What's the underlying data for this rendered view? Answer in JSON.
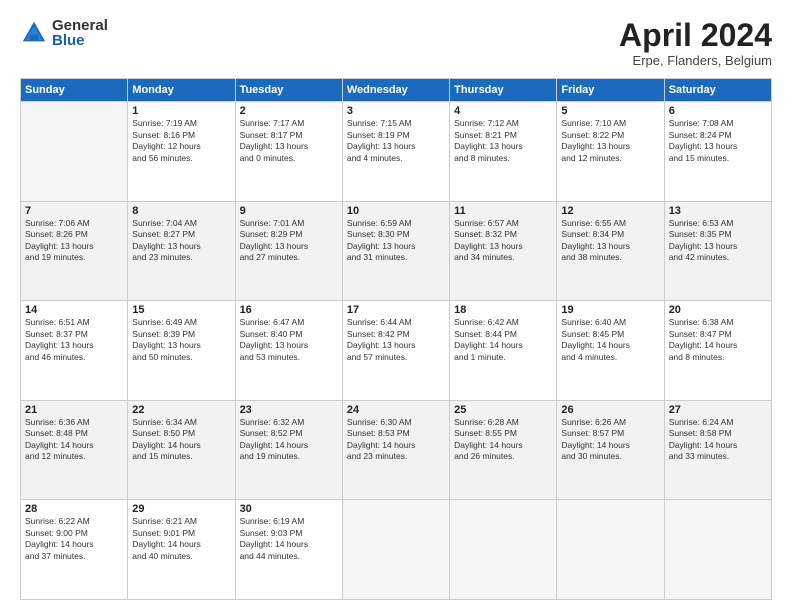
{
  "header": {
    "logo_general": "General",
    "logo_blue": "Blue",
    "title": "April 2024",
    "location": "Erpe, Flanders, Belgium"
  },
  "days_of_week": [
    "Sunday",
    "Monday",
    "Tuesday",
    "Wednesday",
    "Thursday",
    "Friday",
    "Saturday"
  ],
  "weeks": [
    [
      {
        "day": "",
        "info": ""
      },
      {
        "day": "1",
        "info": "Sunrise: 7:19 AM\nSunset: 8:16 PM\nDaylight: 12 hours\nand 56 minutes."
      },
      {
        "day": "2",
        "info": "Sunrise: 7:17 AM\nSunset: 8:17 PM\nDaylight: 13 hours\nand 0 minutes."
      },
      {
        "day": "3",
        "info": "Sunrise: 7:15 AM\nSunset: 8:19 PM\nDaylight: 13 hours\nand 4 minutes."
      },
      {
        "day": "4",
        "info": "Sunrise: 7:12 AM\nSunset: 8:21 PM\nDaylight: 13 hours\nand 8 minutes."
      },
      {
        "day": "5",
        "info": "Sunrise: 7:10 AM\nSunset: 8:22 PM\nDaylight: 13 hours\nand 12 minutes."
      },
      {
        "day": "6",
        "info": "Sunrise: 7:08 AM\nSunset: 8:24 PM\nDaylight: 13 hours\nand 15 minutes."
      }
    ],
    [
      {
        "day": "7",
        "info": "Sunrise: 7:06 AM\nSunset: 8:26 PM\nDaylight: 13 hours\nand 19 minutes."
      },
      {
        "day": "8",
        "info": "Sunrise: 7:04 AM\nSunset: 8:27 PM\nDaylight: 13 hours\nand 23 minutes."
      },
      {
        "day": "9",
        "info": "Sunrise: 7:01 AM\nSunset: 8:29 PM\nDaylight: 13 hours\nand 27 minutes."
      },
      {
        "day": "10",
        "info": "Sunrise: 6:59 AM\nSunset: 8:30 PM\nDaylight: 13 hours\nand 31 minutes."
      },
      {
        "day": "11",
        "info": "Sunrise: 6:57 AM\nSunset: 8:32 PM\nDaylight: 13 hours\nand 34 minutes."
      },
      {
        "day": "12",
        "info": "Sunrise: 6:55 AM\nSunset: 8:34 PM\nDaylight: 13 hours\nand 38 minutes."
      },
      {
        "day": "13",
        "info": "Sunrise: 6:53 AM\nSunset: 8:35 PM\nDaylight: 13 hours\nand 42 minutes."
      }
    ],
    [
      {
        "day": "14",
        "info": "Sunrise: 6:51 AM\nSunset: 8:37 PM\nDaylight: 13 hours\nand 46 minutes."
      },
      {
        "day": "15",
        "info": "Sunrise: 6:49 AM\nSunset: 8:39 PM\nDaylight: 13 hours\nand 50 minutes."
      },
      {
        "day": "16",
        "info": "Sunrise: 6:47 AM\nSunset: 8:40 PM\nDaylight: 13 hours\nand 53 minutes."
      },
      {
        "day": "17",
        "info": "Sunrise: 6:44 AM\nSunset: 8:42 PM\nDaylight: 13 hours\nand 57 minutes."
      },
      {
        "day": "18",
        "info": "Sunrise: 6:42 AM\nSunset: 8:44 PM\nDaylight: 14 hours\nand 1 minute."
      },
      {
        "day": "19",
        "info": "Sunrise: 6:40 AM\nSunset: 8:45 PM\nDaylight: 14 hours\nand 4 minutes."
      },
      {
        "day": "20",
        "info": "Sunrise: 6:38 AM\nSunset: 8:47 PM\nDaylight: 14 hours\nand 8 minutes."
      }
    ],
    [
      {
        "day": "21",
        "info": "Sunrise: 6:36 AM\nSunset: 8:48 PM\nDaylight: 14 hours\nand 12 minutes."
      },
      {
        "day": "22",
        "info": "Sunrise: 6:34 AM\nSunset: 8:50 PM\nDaylight: 14 hours\nand 15 minutes."
      },
      {
        "day": "23",
        "info": "Sunrise: 6:32 AM\nSunset: 8:52 PM\nDaylight: 14 hours\nand 19 minutes."
      },
      {
        "day": "24",
        "info": "Sunrise: 6:30 AM\nSunset: 8:53 PM\nDaylight: 14 hours\nand 23 minutes."
      },
      {
        "day": "25",
        "info": "Sunrise: 6:28 AM\nSunset: 8:55 PM\nDaylight: 14 hours\nand 26 minutes."
      },
      {
        "day": "26",
        "info": "Sunrise: 6:26 AM\nSunset: 8:57 PM\nDaylight: 14 hours\nand 30 minutes."
      },
      {
        "day": "27",
        "info": "Sunrise: 6:24 AM\nSunset: 8:58 PM\nDaylight: 14 hours\nand 33 minutes."
      }
    ],
    [
      {
        "day": "28",
        "info": "Sunrise: 6:22 AM\nSunset: 9:00 PM\nDaylight: 14 hours\nand 37 minutes."
      },
      {
        "day": "29",
        "info": "Sunrise: 6:21 AM\nSunset: 9:01 PM\nDaylight: 14 hours\nand 40 minutes."
      },
      {
        "day": "30",
        "info": "Sunrise: 6:19 AM\nSunset: 9:03 PM\nDaylight: 14 hours\nand 44 minutes."
      },
      {
        "day": "",
        "info": ""
      },
      {
        "day": "",
        "info": ""
      },
      {
        "day": "",
        "info": ""
      },
      {
        "day": "",
        "info": ""
      }
    ]
  ]
}
